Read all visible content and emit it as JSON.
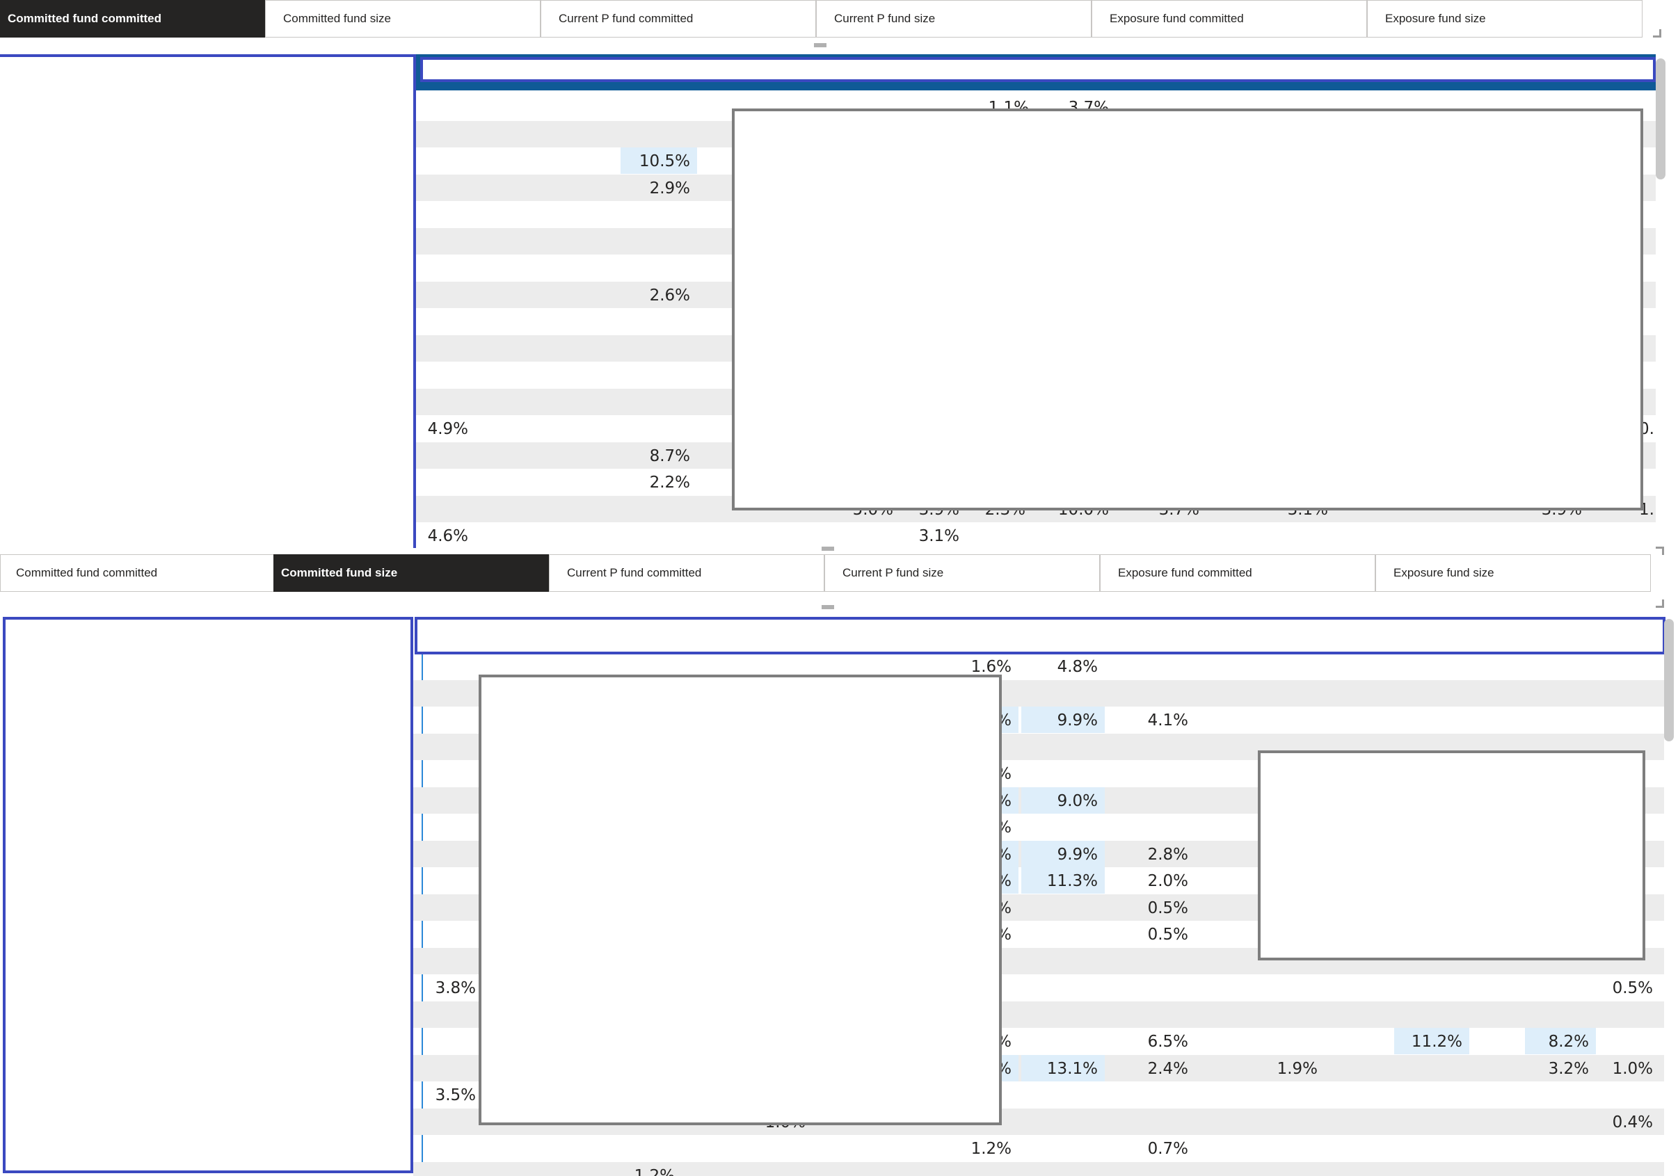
{
  "top": {
    "tabs": [
      "Committed fund committed",
      "Committed fund size",
      "Current P fund committed",
      "Current P fund size",
      "Exposure fund committed",
      "Exposure fund size"
    ],
    "active_tab": 0,
    "cells": [
      {
        "row": 0,
        "col": "c1",
        "text": "1.1%",
        "hl": false
      },
      {
        "row": 0,
        "col": "c2",
        "text": "3.7%",
        "hl": false
      },
      {
        "row": 2,
        "col": "b",
        "text": "10.5%",
        "hl": true
      },
      {
        "row": 3,
        "col": "b",
        "text": "2.9%",
        "hl": false
      },
      {
        "row": 7,
        "col": "b",
        "text": "2.6%",
        "hl": false
      },
      {
        "row": 12,
        "col": "a",
        "text": "4.9%",
        "hl": false
      },
      {
        "row": 12,
        "col": "z",
        "text": "0.",
        "hl": false
      },
      {
        "row": 13,
        "col": "b",
        "text": "8.7%",
        "hl": false
      },
      {
        "row": 14,
        "col": "b",
        "text": "2.2%",
        "hl": false
      },
      {
        "row": 15,
        "col": "d",
        "text": "5.0%",
        "hl": false
      },
      {
        "row": 15,
        "col": "e",
        "text": "3.9%",
        "hl": false
      },
      {
        "row": 15,
        "col": "f",
        "text": "2.3%",
        "hl": false
      },
      {
        "row": 15,
        "col": "g",
        "text": "10.0%",
        "hl": false
      },
      {
        "row": 15,
        "col": "h",
        "text": "3.7%",
        "hl": false
      },
      {
        "row": 15,
        "col": "i",
        "text": "3.1%",
        "hl": false
      },
      {
        "row": 15,
        "col": "j",
        "text": "3.9%",
        "hl": false
      },
      {
        "row": 15,
        "col": "z",
        "text": "1.",
        "hl": false
      },
      {
        "row": 16,
        "col": "a",
        "text": "4.6%",
        "hl": false
      },
      {
        "row": 16,
        "col": "e",
        "text": "3.1%",
        "hl": false
      }
    ]
  },
  "bottom": {
    "tabs": [
      "Committed fund committed",
      "Committed fund size",
      "Current P fund committed",
      "Current P fund size",
      "Exposure fund committed",
      "Exposure fund size"
    ],
    "active_tab": 1,
    "cells": [
      {
        "row": 0,
        "col": "p",
        "text": "1.6%",
        "hl": false
      },
      {
        "row": 0,
        "col": "q",
        "text": "4.8%",
        "hl": false
      },
      {
        "row": 2,
        "col": "p",
        "text": "2%",
        "hl": true
      },
      {
        "row": 2,
        "col": "q",
        "text": "9.9%",
        "hl": true
      },
      {
        "row": 2,
        "col": "r",
        "text": "4.1%",
        "hl": false
      },
      {
        "row": 4,
        "col": "p",
        "text": "9%",
        "hl": false
      },
      {
        "row": 5,
        "col": "p",
        "text": "9%",
        "hl": true
      },
      {
        "row": 5,
        "col": "q",
        "text": "9.0%",
        "hl": true
      },
      {
        "row": 6,
        "col": "p",
        "text": "2%",
        "hl": false
      },
      {
        "row": 7,
        "col": "p",
        "text": "2%",
        "hl": true
      },
      {
        "row": 7,
        "col": "q",
        "text": "9.9%",
        "hl": true
      },
      {
        "row": 7,
        "col": "r",
        "text": "2.8%",
        "hl": false
      },
      {
        "row": 8,
        "col": "p",
        "text": "2%",
        "hl": true
      },
      {
        "row": 8,
        "col": "q",
        "text": "11.3%",
        "hl": true
      },
      {
        "row": 8,
        "col": "r",
        "text": "2.0%",
        "hl": false
      },
      {
        "row": 9,
        "col": "p",
        "text": "9%",
        "hl": false
      },
      {
        "row": 9,
        "col": "r",
        "text": "0.5%",
        "hl": false
      },
      {
        "row": 10,
        "col": "p",
        "text": "9%",
        "hl": false
      },
      {
        "row": 10,
        "col": "r",
        "text": "0.5%",
        "hl": false
      },
      {
        "row": 12,
        "col": "a",
        "text": "3.8%",
        "hl": false
      },
      {
        "row": 12,
        "col": "z",
        "text": "0.5%",
        "hl": false
      },
      {
        "row": 14,
        "col": "p",
        "text": "9%",
        "hl": false
      },
      {
        "row": 14,
        "col": "r",
        "text": "6.5%",
        "hl": false
      },
      {
        "row": 14,
        "col": "t",
        "text": "11.2%",
        "hl": true
      },
      {
        "row": 14,
        "col": "u",
        "text": "8.2%",
        "hl": true
      },
      {
        "row": 15,
        "col": "p",
        "text": "5%",
        "hl": true
      },
      {
        "row": 15,
        "col": "q",
        "text": "13.1%",
        "hl": true
      },
      {
        "row": 15,
        "col": "r",
        "text": "2.4%",
        "hl": false
      },
      {
        "row": 15,
        "col": "s",
        "text": "1.9%",
        "hl": false
      },
      {
        "row": 15,
        "col": "u",
        "text": "3.2%",
        "hl": false
      },
      {
        "row": 15,
        "col": "z",
        "text": "1.0%",
        "hl": false
      },
      {
        "row": 16,
        "col": "a",
        "text": "3.5%",
        "hl": false
      },
      {
        "row": 17,
        "col": "o",
        "text": "1.0%",
        "hl": false
      },
      {
        "row": 17,
        "col": "z",
        "text": "0.4%",
        "hl": false
      },
      {
        "row": 18,
        "col": "p",
        "text": "1.2%",
        "hl": false
      },
      {
        "row": 18,
        "col": "r",
        "text": "0.7%",
        "hl": false
      },
      {
        "row": 19,
        "col": "n",
        "text": "1.2%",
        "hl": false
      }
    ]
  }
}
